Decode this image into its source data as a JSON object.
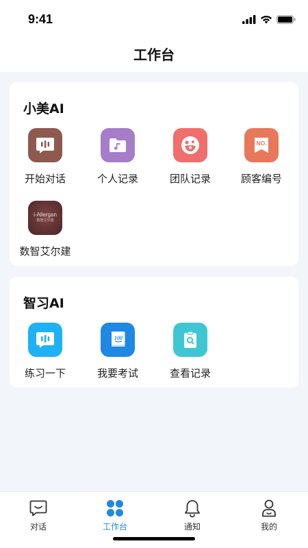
{
  "status_bar": {
    "time": "9:41"
  },
  "header": {
    "title": "工作台"
  },
  "sections": [
    {
      "title": "小美AI",
      "items": [
        {
          "label": "开始对话",
          "icon": "voice-bars-icon",
          "color": "#8E5A4F"
        },
        {
          "label": "个人记录",
          "icon": "music-folder-icon",
          "color": "#A57DC9"
        },
        {
          "label": "团队记录",
          "icon": "team-face-icon",
          "color": "#EF6F6C"
        },
        {
          "label": "顾客编号",
          "icon": "number-ribbon-icon",
          "color": "#E8785A"
        },
        {
          "label": "数智艾尔建",
          "icon": "allergan-logo",
          "color": "#6B3B3B",
          "logo_text": "i-Allergan",
          "logo_subtext": "数智艾尔建"
        }
      ]
    },
    {
      "title": "智习AI",
      "items": [
        {
          "label": "练习一下",
          "icon": "voice-bars-icon",
          "color": "#1EB1F5"
        },
        {
          "label": "我要考试",
          "icon": "exam-book-icon",
          "color": "#1E88E5"
        },
        {
          "label": "查看记录",
          "icon": "clipboard-search-icon",
          "color": "#3EC7D3"
        }
      ]
    }
  ],
  "tabs": [
    {
      "label": "对话",
      "icon": "chat-icon",
      "active": false
    },
    {
      "label": "工作台",
      "icon": "workbench-icon",
      "active": true
    },
    {
      "label": "通知",
      "icon": "bell-icon",
      "active": false
    },
    {
      "label": "我的",
      "icon": "profile-icon",
      "active": false
    }
  ],
  "colors": {
    "accent": "#1E88E5",
    "background": "#F2F5F9"
  }
}
